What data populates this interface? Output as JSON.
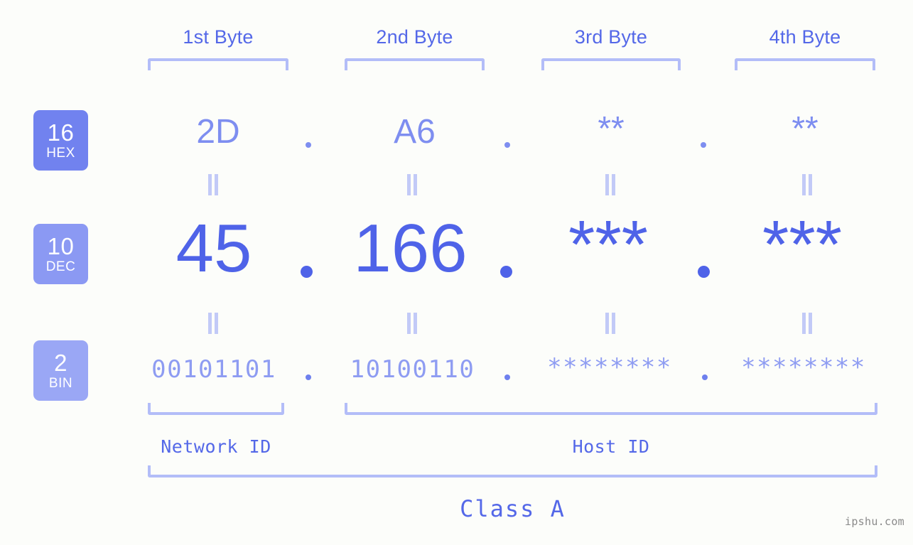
{
  "background_color": "#fcfdfa",
  "accent": {
    "strong_blue": "#4f63e8",
    "mid_blue": "#7e8ef0",
    "light_blue": "#b3bdf8",
    "pale_blue": "#c2caf7",
    "label_blue": "#5468e8",
    "watermark_gray": "#8a8a8a"
  },
  "headers": {
    "byte_1": "1st Byte",
    "byte_2": "2nd Byte",
    "byte_3": "3rd Byte",
    "byte_4": "4th Byte"
  },
  "bases": [
    {
      "number": "16",
      "abbr": "HEX",
      "color": "#7182ef"
    },
    {
      "number": "10",
      "abbr": "DEC",
      "color": "#8b99f3"
    },
    {
      "number": "2",
      "abbr": "BIN",
      "color": "#9aa7f5"
    }
  ],
  "rows": {
    "hex": {
      "base_number": "16",
      "base_abbr": "HEX",
      "values": [
        "2D",
        "A6",
        "**",
        "**"
      ],
      "separator": "."
    },
    "dec": {
      "base_number": "10",
      "base_abbr": "DEC",
      "values": [
        "45",
        "166",
        "***",
        "***"
      ],
      "separator": "."
    },
    "bin": {
      "base_number": "2",
      "base_abbr": "BIN",
      "values": [
        "00101101",
        "10100110",
        "********",
        "********"
      ],
      "separator": "."
    }
  },
  "equality_symbol": "||",
  "sections": {
    "network_id": "Network ID",
    "host_id": "Host ID",
    "class": "Class A"
  },
  "watermark": "ipshu.com"
}
